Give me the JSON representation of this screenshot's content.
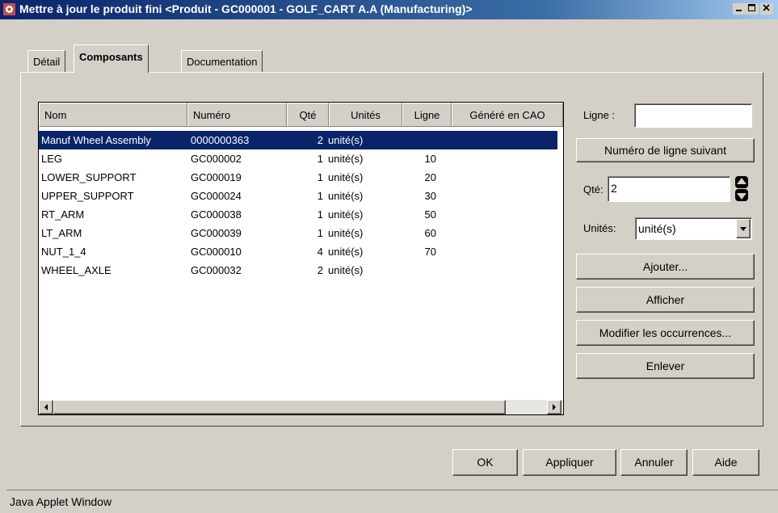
{
  "window": {
    "title": "Mettre à jour le produit fini <Produit - GC000001 - GOLF_CART A.A (Manufacturing)>",
    "buttons": [
      "minimize",
      "maximize",
      "close"
    ]
  },
  "tabs": [
    {
      "label": "Détail",
      "active": false
    },
    {
      "label": "Composants",
      "active": true
    },
    {
      "label": "Documentation",
      "active": false
    }
  ],
  "table": {
    "columns": [
      "Nom",
      "Numéro",
      "Qté",
      "Unités",
      "Ligne",
      "Généré en CAO"
    ],
    "rows": [
      {
        "nom": "Manuf Wheel Assembly",
        "numero": "0000000363",
        "qte": "2",
        "unites": "unité(s)",
        "ligne": "",
        "cao": "",
        "selected": true
      },
      {
        "nom": "LEG",
        "numero": "GC000002",
        "qte": "1",
        "unites": "unité(s)",
        "ligne": "10",
        "cao": ""
      },
      {
        "nom": "LOWER_SUPPORT",
        "numero": "GC000019",
        "qte": "1",
        "unites": "unité(s)",
        "ligne": "20",
        "cao": ""
      },
      {
        "nom": "UPPER_SUPPORT",
        "numero": "GC000024",
        "qte": "1",
        "unites": "unité(s)",
        "ligne": "30",
        "cao": ""
      },
      {
        "nom": "RT_ARM",
        "numero": "GC000038",
        "qte": "1",
        "unites": "unité(s)",
        "ligne": "50",
        "cao": ""
      },
      {
        "nom": "LT_ARM",
        "numero": "GC000039",
        "qte": "1",
        "unites": "unité(s)",
        "ligne": "60",
        "cao": ""
      },
      {
        "nom": "NUT_1_4",
        "numero": "GC000010",
        "qte": "4",
        "unites": "unité(s)",
        "ligne": "70",
        "cao": ""
      },
      {
        "nom": "WHEEL_AXLE",
        "numero": "GC000032",
        "qte": "2",
        "unites": "unité(s)",
        "ligne": "",
        "cao": ""
      }
    ]
  },
  "side": {
    "ligne_label": "Ligne :",
    "ligne_value": "",
    "next_line_button": "Numéro de ligne suivant",
    "qte_label": "Qté:",
    "qte_value": "2",
    "unites_label": "Unités:",
    "unites_value": "unité(s)",
    "add_button": "Ajouter...",
    "show_button": "Afficher",
    "modify_button": "Modifier les occurrences...",
    "remove_button": "Enlever"
  },
  "footer": {
    "ok": "OK",
    "apply": "Appliquer",
    "cancel": "Annuler",
    "help": "Aide"
  },
  "status": "Java Applet Window",
  "colors": {
    "title_gradient_start": "#0a246a",
    "selection": "#0a246a",
    "face": "#d4d0c8"
  }
}
